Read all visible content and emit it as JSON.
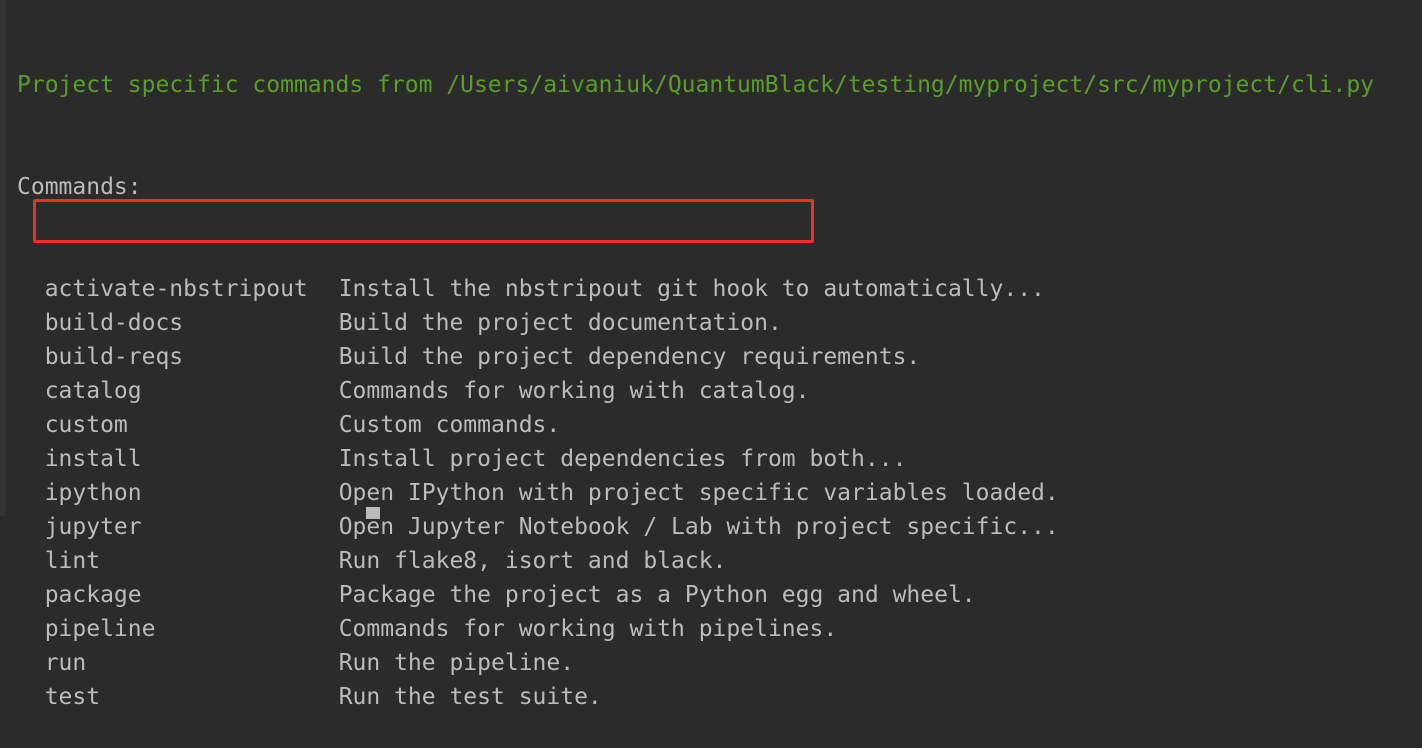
{
  "header": "Project specific commands from /Users/aivaniuk/QuantumBlack/testing/myproject/src/myproject/cli.py",
  "commands_label": "Commands:",
  "commands": [
    {
      "name": "activate-nbstripout",
      "desc": "Install the nbstripout git hook to automatically..."
    },
    {
      "name": "build-docs",
      "desc": "Build the project documentation."
    },
    {
      "name": "build-reqs",
      "desc": "Build the project dependency requirements."
    },
    {
      "name": "catalog",
      "desc": "Commands for working with catalog."
    },
    {
      "name": "custom",
      "desc": "Custom commands."
    },
    {
      "name": "install",
      "desc": "Install project dependencies from both..."
    },
    {
      "name": "ipython",
      "desc": "Open IPython with project specific variables loaded."
    },
    {
      "name": "jupyter",
      "desc": "Open Jupyter Notebook / Lab with project specific..."
    },
    {
      "name": "lint",
      "desc": "Run flake8, isort and black."
    },
    {
      "name": "package",
      "desc": "Package the project as a Python egg and wheel."
    },
    {
      "name": "pipeline",
      "desc": "Commands for working with pipelines."
    },
    {
      "name": "run",
      "desc": "Run the pipeline."
    },
    {
      "name": "test",
      "desc": "Run the test suite."
    }
  ],
  "colors": {
    "header": "#5a9d2a",
    "highlight": "#e8312a",
    "background": "#2b2b2b"
  }
}
